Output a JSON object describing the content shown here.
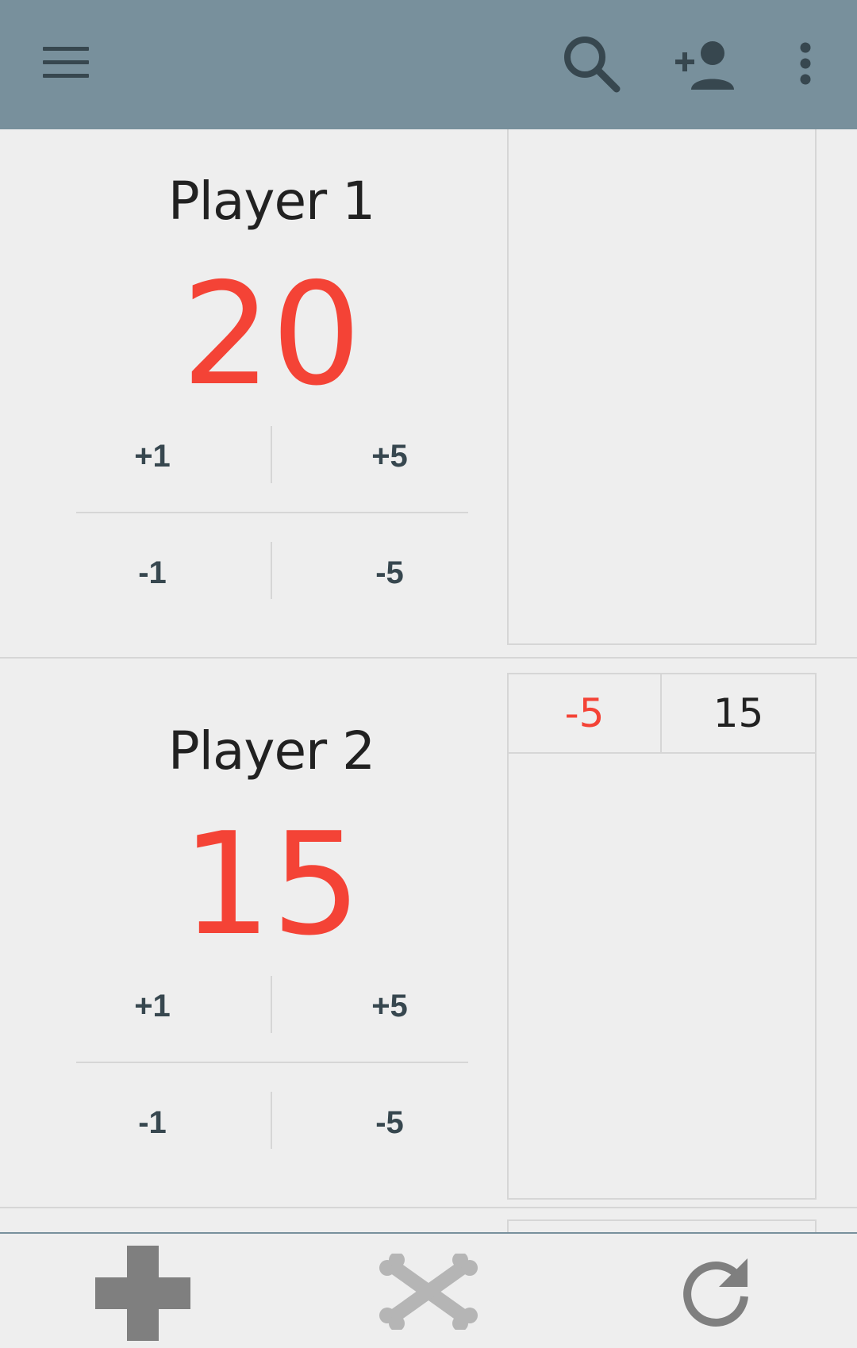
{
  "app": {
    "accent_color": "#78909c",
    "life_color": "#f44336"
  },
  "toolbar": {
    "icons": [
      "menu-icon",
      "search-icon",
      "add-person-icon",
      "more-vert-icon"
    ]
  },
  "players": [
    {
      "name": "Player 1",
      "life": "20",
      "buttons": {
        "plus1": "+1",
        "plus5": "+5",
        "minus1": "-1",
        "minus5": "-5"
      },
      "history": []
    },
    {
      "name": "Player 2",
      "life": "15",
      "buttons": {
        "plus1": "+1",
        "plus5": "+5",
        "minus1": "-1",
        "minus5": "-5"
      },
      "history": [
        {
          "delta": "-5",
          "total": "15"
        }
      ]
    }
  ],
  "bottom_bar": {
    "icons": [
      "add-icon",
      "crossbones-icon",
      "reset-icon"
    ]
  }
}
